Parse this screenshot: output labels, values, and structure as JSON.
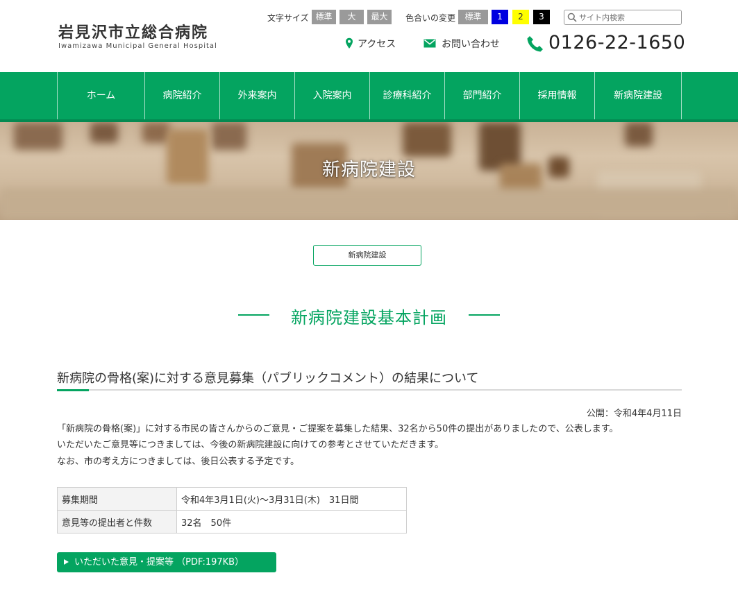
{
  "header": {
    "logo_ja": "岩見沢市立総合病院",
    "logo_en": "Iwamizawa Municipal General Hospital",
    "font_size_label": "文字サイズ",
    "font_size_options": [
      "標準",
      "大",
      "最大"
    ],
    "color_label": "色合いの変更",
    "color_options": [
      "標準",
      "1",
      "2",
      "3"
    ],
    "search_placeholder": "サイト内検索",
    "access_label": "アクセス",
    "contact_label": "お問い合わせ",
    "phone": "0126-22-1650"
  },
  "nav": {
    "items": [
      "ホーム",
      "病院紹介",
      "外来案内",
      "入院案内",
      "診療科紹介",
      "部門紹介",
      "採用情報",
      "新病院建設"
    ]
  },
  "hero": {
    "title": "新病院建設"
  },
  "breadcrumb": {
    "label": "新病院建設"
  },
  "section": {
    "title": "新病院建設基本計画"
  },
  "article": {
    "title": "新病院の骨格(案)に対する意見募集（パブリックコメント）の結果について",
    "published": "公開：令和4年4月11日",
    "paragraphs": [
      "「新病院の骨格(案)」に対する市民の皆さんからのご意見・ご提案を募集した結果、32名から50件の提出がありましたので、公表します。",
      "いただいたご意見等につきましては、今後の新病院建設に向けての参考とさせていただきます。",
      "なお、市の考え方につきましては、後日公表する予定です。"
    ],
    "table": [
      {
        "label": "募集期間",
        "value": "令和4年3月1日(火)～3月31日(木)　31日間"
      },
      {
        "label": "意見等の提出者と件数",
        "value": "32名　50件"
      }
    ],
    "pdf_link": "いただいた意見・提案等 （PDF:197KB）"
  },
  "colors": {
    "brand_green": "#04a460",
    "color_option_1": "#0000e0",
    "color_option_2": "#ffff00",
    "color_option_3": "#000000"
  },
  "icons": [
    "search-icon",
    "map-pin-icon",
    "mail-icon",
    "phone-icon",
    "triangle-right-icon"
  ]
}
